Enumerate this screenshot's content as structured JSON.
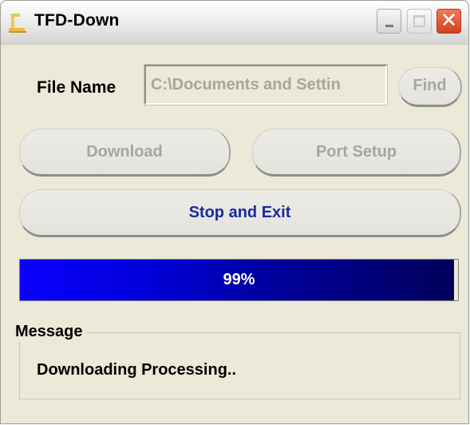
{
  "window": {
    "title": "TFD-Down"
  },
  "titlebar": {
    "minimize_icon": "minimize-icon",
    "maximize_icon": "maximize-icon",
    "close_icon": "close-icon",
    "close_glyph": "✕"
  },
  "file": {
    "label": "File Name",
    "value": "C:\\Documents and Settin",
    "find_label": "Find"
  },
  "actions": {
    "download_label": "Download",
    "port_setup_label": "Port Setup",
    "stop_exit_label": "Stop and Exit"
  },
  "progress": {
    "value": 0.99,
    "text": "99%"
  },
  "message": {
    "legend": "Message",
    "text": "Downloading Processing.."
  },
  "colors": {
    "window_bg": "#ece9d8",
    "stop_text": "#1a2aa0",
    "disabled_text": "#a7a69e",
    "progress_start": "#0a00ff",
    "progress_end": "#00005a",
    "close_button": "#d4401e"
  }
}
